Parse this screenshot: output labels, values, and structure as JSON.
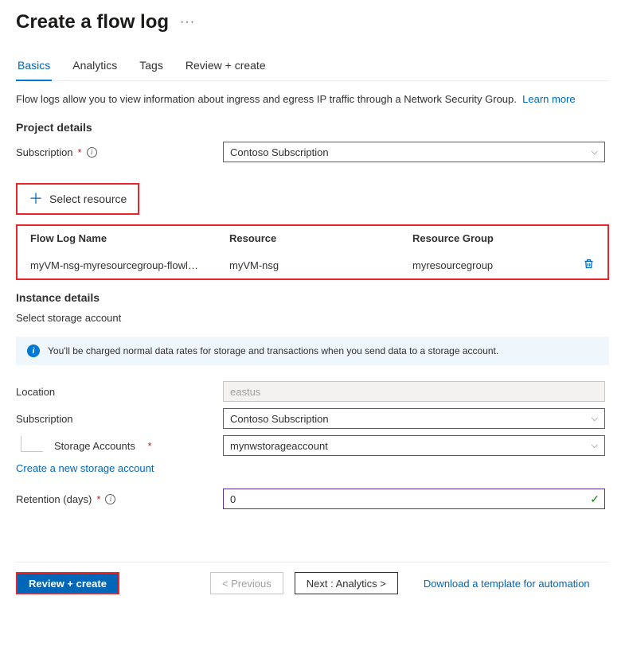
{
  "header": {
    "title": "Create a flow log"
  },
  "tabs": [
    "Basics",
    "Analytics",
    "Tags",
    "Review + create"
  ],
  "activeTab": "Basics",
  "description": "Flow logs allow you to view information about ingress and egress IP traffic through a Network Security Group.",
  "learnMore": "Learn more",
  "project": {
    "heading": "Project details",
    "subscriptionLabel": "Subscription",
    "subscriptionValue": "Contoso Subscription",
    "selectResource": "Select resource",
    "table": {
      "h1": "Flow Log Name",
      "h2": "Resource",
      "h3": "Resource Group",
      "r1c1": "myVM-nsg-myresourcegroup-flowl…",
      "r1c2": "myVM-nsg",
      "r1c3": "myresourcegroup"
    }
  },
  "instance": {
    "heading": "Instance details",
    "selectStorage": "Select storage account",
    "infoMsg": "You'll be charged normal data rates for storage and transactions when you send data to a storage account.",
    "locationLabel": "Location",
    "locationValue": "eastus",
    "subscriptionLabel": "Subscription",
    "subscriptionValue": "Contoso Subscription",
    "storageLabel": "Storage Accounts",
    "storageValue": "mynwstorageaccount",
    "createNew": "Create a new storage account",
    "retentionLabel": "Retention (days)",
    "retentionValue": "0"
  },
  "footer": {
    "review": "Review + create",
    "prev": "< Previous",
    "next": "Next : Analytics >",
    "download": "Download a template for automation"
  }
}
